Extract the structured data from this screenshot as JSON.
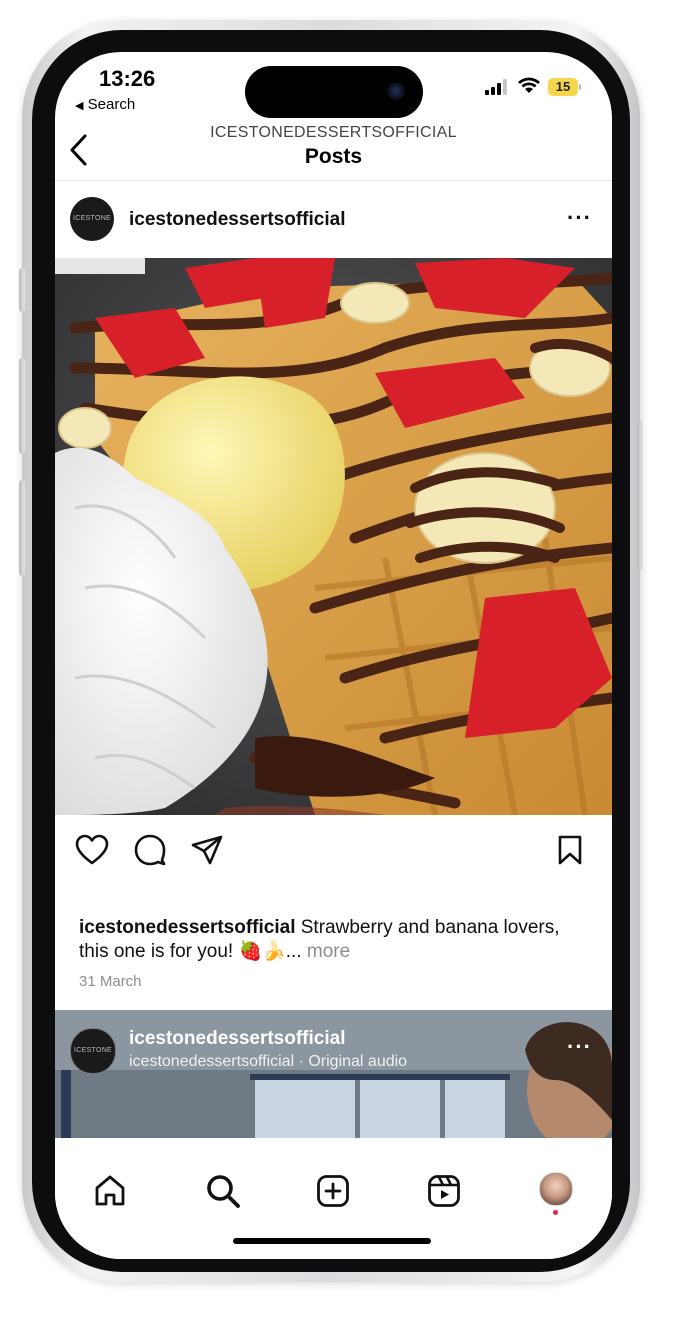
{
  "status": {
    "time": "13:26",
    "back_app": "Search",
    "battery": "15"
  },
  "header": {
    "account": "ICESTONEDESSERTSOFFICIAL",
    "title": "Posts"
  },
  "post": {
    "username": "icestonedessertsofficial",
    "avatar_text": "ICESTONE",
    "caption_user": "icestonedessertsofficial",
    "caption_text": " Strawberry and banana lovers, this one is for you! 🍓🍌... ",
    "more_label": "more",
    "date": "31 March"
  },
  "next_post": {
    "username": "icestonedessertsofficial",
    "audio": "icestonedessertsofficial · Original audio",
    "avatar_text": "ICESTONE"
  },
  "nav": {
    "items": [
      "home-icon",
      "search-icon",
      "create-icon",
      "reels-icon",
      "profile-avatar"
    ]
  },
  "colors": {
    "battery": "#f6d64a",
    "notification_dot": "#e0245e"
  }
}
